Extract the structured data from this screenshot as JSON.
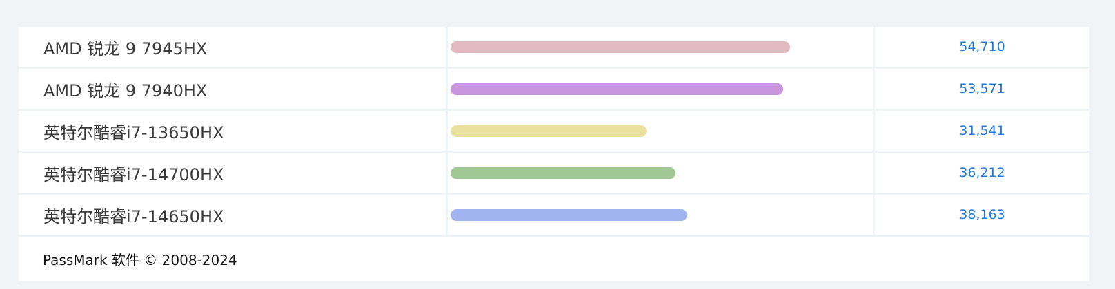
{
  "chart_data": {
    "type": "bar",
    "orientation": "horizontal",
    "categories": [
      "AMD 锐龙 9 7945HX",
      "AMD 锐龙 9 7940HX",
      "英特尔酷睿i7-13650HX",
      "英特尔酷睿i7-14700HX",
      "英特尔酷睿i7-14650HX"
    ],
    "values": [
      54710,
      53571,
      31541,
      36212,
      38163
    ],
    "value_labels": [
      "54,710",
      "53,571",
      "31,541",
      "36,212",
      "38,163"
    ],
    "bar_colors": [
      "#e0babf",
      "#c995dc",
      "#ebe19e",
      "#9fc894",
      "#a1b4f0"
    ],
    "xlim": [
      0,
      68000
    ],
    "title": "",
    "xlabel": "",
    "ylabel": ""
  },
  "footer": {
    "text": "PassMark 软件 © 2008-2024"
  }
}
